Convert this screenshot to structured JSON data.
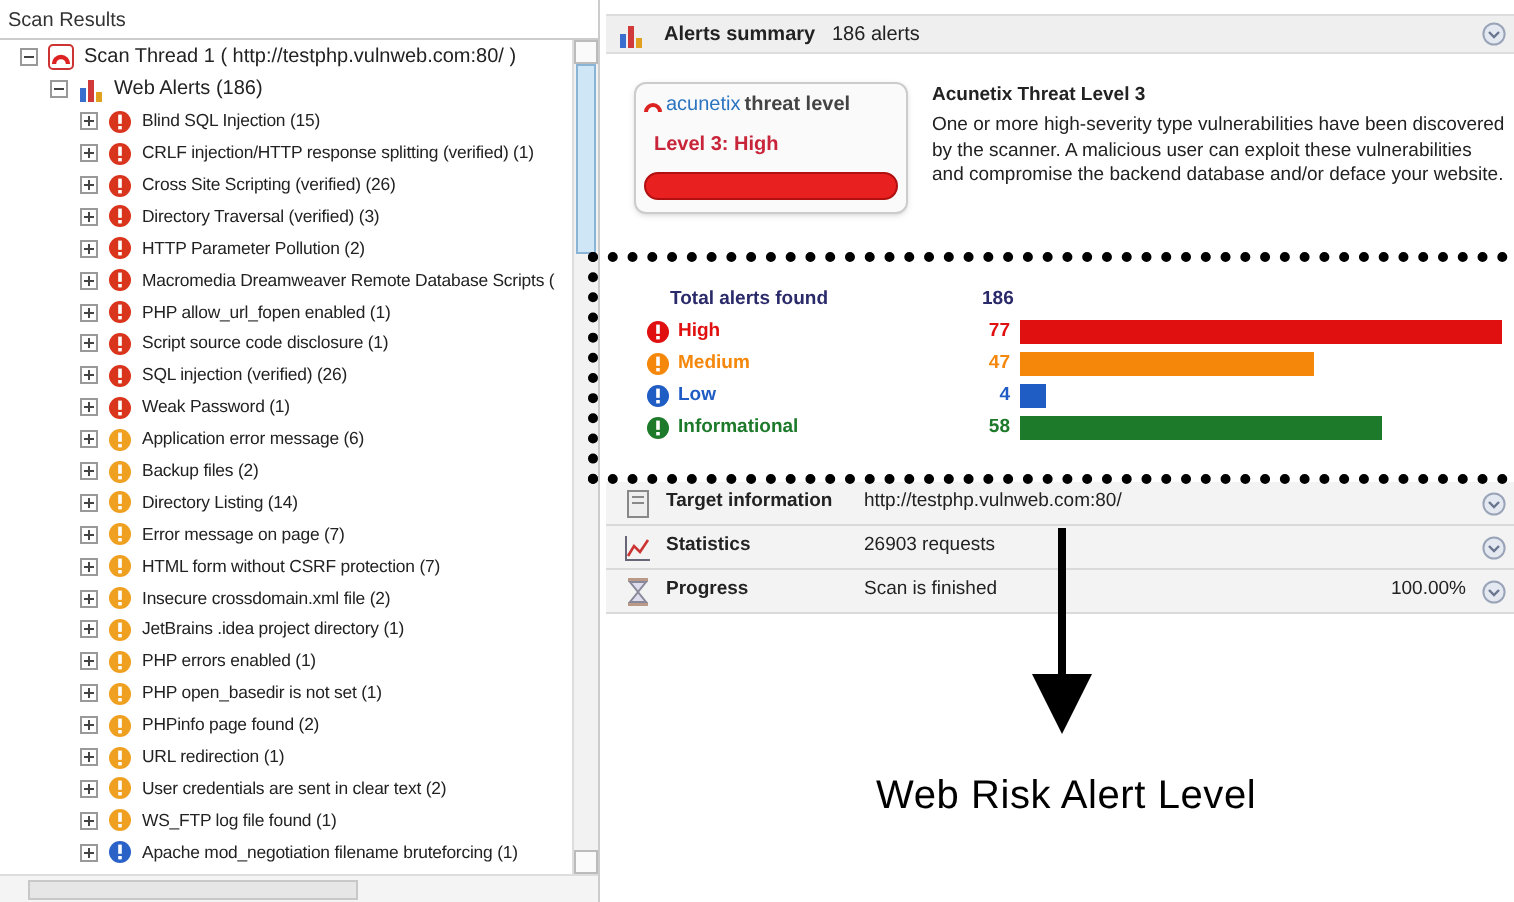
{
  "left_panel": {
    "title": "Scan Results",
    "tree": {
      "label": "Scan Thread 1 ( http://testphp.vulnweb.com:80/ )",
      "expanded": true,
      "children": [
        {
          "label": "Web Alerts (186)",
          "expanded": true,
          "children": [
            {
              "label": "Blind SQL Injection (15)",
              "kind": "high",
              "expanded": false
            },
            {
              "label": "CRLF injection/HTTP response splitting (verified) (1)",
              "kind": "high",
              "expanded": false
            },
            {
              "label": "Cross Site Scripting (verified) (26)",
              "kind": "high",
              "expanded": false
            },
            {
              "label": "Directory Traversal (verified) (3)",
              "kind": "high",
              "expanded": false
            },
            {
              "label": "HTTP Parameter Pollution (2)",
              "kind": "high",
              "expanded": false
            },
            {
              "label": "Macromedia Dreamweaver Remote Database Scripts (",
              "kind": "high",
              "expanded": false
            },
            {
              "label": "PHP allow_url_fopen enabled (1)",
              "kind": "high",
              "expanded": false
            },
            {
              "label": "Script source code disclosure (1)",
              "kind": "high",
              "expanded": false
            },
            {
              "label": "SQL injection (verified) (26)",
              "kind": "high",
              "expanded": false
            },
            {
              "label": "Weak Password (1)",
              "kind": "high",
              "expanded": false
            },
            {
              "label": "Application error message (6)",
              "kind": "medium",
              "expanded": false
            },
            {
              "label": "Backup files (2)",
              "kind": "medium",
              "expanded": false
            },
            {
              "label": "Directory Listing (14)",
              "kind": "medium",
              "expanded": false
            },
            {
              "label": "Error message on page (7)",
              "kind": "medium",
              "expanded": false
            },
            {
              "label": "HTML form without CSRF protection (7)",
              "kind": "medium",
              "expanded": false
            },
            {
              "label": "Insecure crossdomain.xml file (2)",
              "kind": "medium",
              "expanded": false
            },
            {
              "label": "JetBrains .idea project directory (1)",
              "kind": "medium",
              "expanded": false
            },
            {
              "label": "PHP errors enabled (1)",
              "kind": "medium",
              "expanded": false
            },
            {
              "label": "PHP open_basedir is not set (1)",
              "kind": "medium",
              "expanded": false
            },
            {
              "label": "PHPinfo page found (2)",
              "kind": "medium",
              "expanded": false
            },
            {
              "label": "URL redirection (1)",
              "kind": "medium",
              "expanded": false
            },
            {
              "label": "User credentials are sent in clear text (2)",
              "kind": "medium",
              "expanded": false
            },
            {
              "label": "WS_FTP log file found (1)",
              "kind": "medium",
              "expanded": false
            },
            {
              "label": "Apache mod_negotiation filename bruteforcing (1)",
              "kind": "low",
              "expanded": false
            }
          ]
        }
      ]
    }
  },
  "summary": {
    "title": "Alerts summary",
    "count": "186 alerts",
    "threat_box": {
      "brand": "acunetix",
      "title": "threat level",
      "level_label": "Level 3: High"
    },
    "threat_heading": "Acunetix Threat Level 3",
    "threat_text": "One or more high-severity type vulnerabilities have been discovered by the scanner. A malicious user can exploit these vulnerabilities and compromise the backend database and/or deface your website.",
    "total": {
      "label": "Total alerts found",
      "count": "186"
    },
    "severities": [
      {
        "label": "High",
        "count": "77",
        "color": "#e01010"
      },
      {
        "label": "Medium",
        "count": "47",
        "color": "#f5870a"
      },
      {
        "label": "Low",
        "count": "4",
        "color": "#1f5cc4"
      },
      {
        "label": "Informational",
        "count": "58",
        "color": "#1d7a2a"
      }
    ]
  },
  "info_rows": [
    {
      "kind": "target",
      "label": "Target information",
      "value": "http://testphp.vulnweb.com:80/"
    },
    {
      "kind": "statistics",
      "label": "Statistics",
      "value": "26903 requests"
    },
    {
      "kind": "progress",
      "label": "Progress",
      "value": "Scan is finished",
      "extra": "100.00%"
    }
  ],
  "annotation": {
    "caption": "Web Risk Alert Level"
  }
}
